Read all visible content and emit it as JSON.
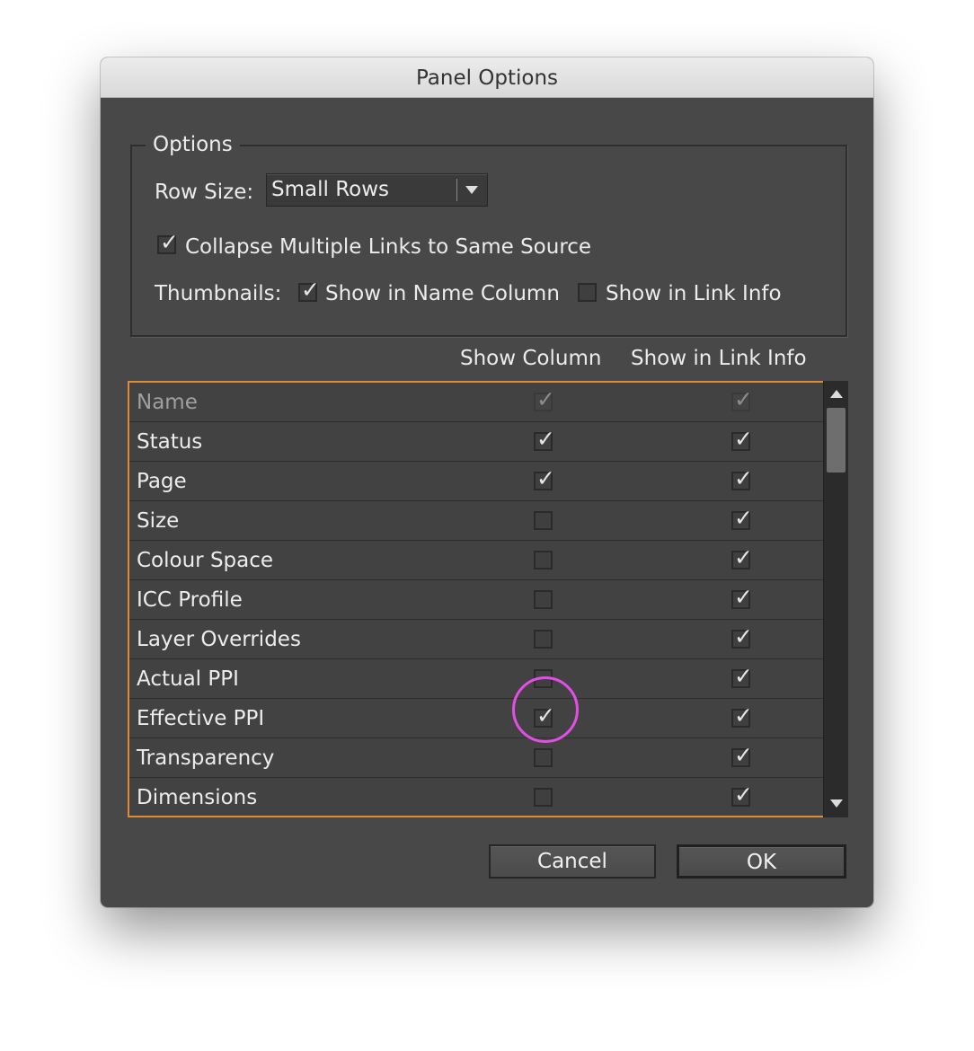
{
  "window": {
    "title": "Panel Options"
  },
  "options": {
    "legend": "Options",
    "row_size_label": "Row Size:",
    "row_size_value": "Small Rows",
    "collapse_label": "Collapse Multiple Links to Same Source",
    "collapse_checked": true,
    "thumbnails_label": "Thumbnails:",
    "thumb_name_label": "Show in Name Column",
    "thumb_name_checked": true,
    "thumb_info_label": "Show in Link Info",
    "thumb_info_checked": false
  },
  "columns": {
    "show_column": "Show Column",
    "show_in_link_info": "Show in Link Info"
  },
  "rows": [
    {
      "label": "Name",
      "show_column": true,
      "show_info": true,
      "disabled": true
    },
    {
      "label": "Status",
      "show_column": true,
      "show_info": true,
      "disabled": false
    },
    {
      "label": "Page",
      "show_column": true,
      "show_info": true,
      "disabled": false
    },
    {
      "label": "Size",
      "show_column": false,
      "show_info": true,
      "disabled": false
    },
    {
      "label": "Colour Space",
      "show_column": false,
      "show_info": true,
      "disabled": false
    },
    {
      "label": "ICC Profile",
      "show_column": false,
      "show_info": true,
      "disabled": false
    },
    {
      "label": "Layer Overrides",
      "show_column": false,
      "show_info": true,
      "disabled": false
    },
    {
      "label": "Actual PPI",
      "show_column": false,
      "show_info": true,
      "disabled": false
    },
    {
      "label": "Effective PPI",
      "show_column": true,
      "show_info": true,
      "disabled": false,
      "highlighted": true
    },
    {
      "label": "Transparency",
      "show_column": false,
      "show_info": true,
      "disabled": false
    },
    {
      "label": "Dimensions",
      "show_column": false,
      "show_info": true,
      "disabled": false
    }
  ],
  "buttons": {
    "cancel": "Cancel",
    "ok": "OK"
  },
  "colors": {
    "list_border": "#e08a33",
    "highlight": "#e24ee6",
    "background": "#484848"
  },
  "icons": {
    "check": "checkmark-icon",
    "dropdown": "triangle-down-icon",
    "scroll_up": "triangle-up-icon",
    "scroll_down": "triangle-down-icon"
  }
}
